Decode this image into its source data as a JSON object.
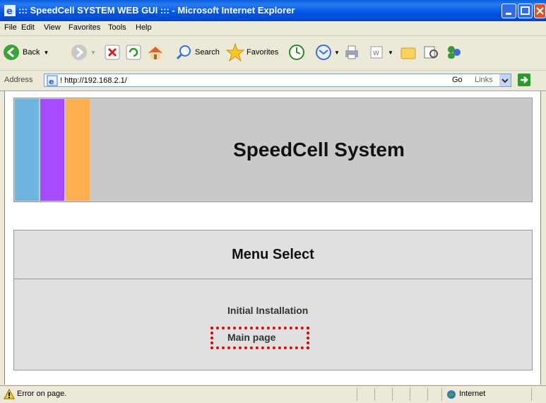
{
  "window": {
    "title": "::: SpeedCell SYSTEM WEB GUI ::: - Microsoft Internet Explorer"
  },
  "menubar": {
    "items": [
      "File",
      "Edit",
      "View",
      "Favorites",
      "Tools",
      "Help"
    ]
  },
  "toolbar": {
    "back_label": "Back",
    "search_label": "Search",
    "favorites_label": "Favorites"
  },
  "address": {
    "label": "Address",
    "url": "! http://192.168.2.1/",
    "go_label": "Go",
    "links_label": "Links"
  },
  "page": {
    "banner_title": "SpeedCell System",
    "stripe_colors": [
      "#6EB6E0",
      "#A64BFF",
      "#FFAF52"
    ],
    "menu_header": "Menu Select",
    "menu_items": [
      "Initial Installation",
      "Main page"
    ],
    "highlight_color": "#E00000"
  },
  "status": {
    "text": "Error on page.",
    "zone": "Internet"
  }
}
